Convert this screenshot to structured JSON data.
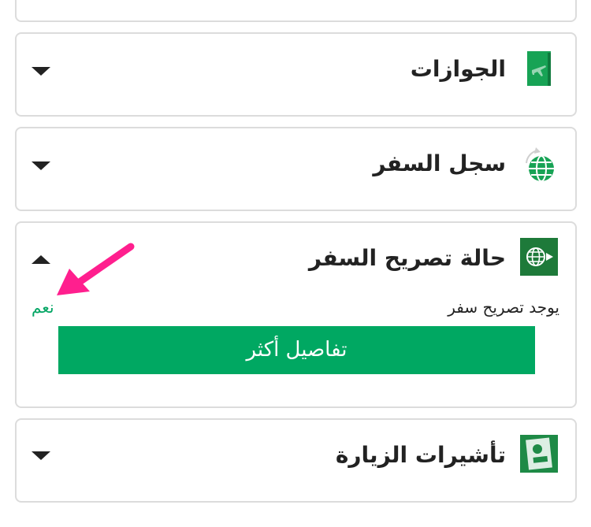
{
  "sections": [
    {
      "id": "passports",
      "title": "الجوازات",
      "icon": "passport-icon",
      "expanded": false
    },
    {
      "id": "travel_record",
      "title": "سجل السفر",
      "icon": "globe-plane-icon",
      "expanded": false
    },
    {
      "id": "travel_permit",
      "title": "حالة تصريح السفر",
      "icon": "globe-arrow-icon",
      "expanded": true,
      "status_label": "يوجد تصريح سفر",
      "status_value": "نعم",
      "button_label": "تفاصيل أكثر"
    },
    {
      "id": "visit_visas",
      "title": "تأشيرات الزيارة",
      "icon": "visa-icon",
      "expanded": false
    }
  ],
  "colors": {
    "accent": "#00a862",
    "status_yes": "#00a563",
    "annotation_arrow": "#ff1f8e",
    "border": "#dcdcdc"
  }
}
